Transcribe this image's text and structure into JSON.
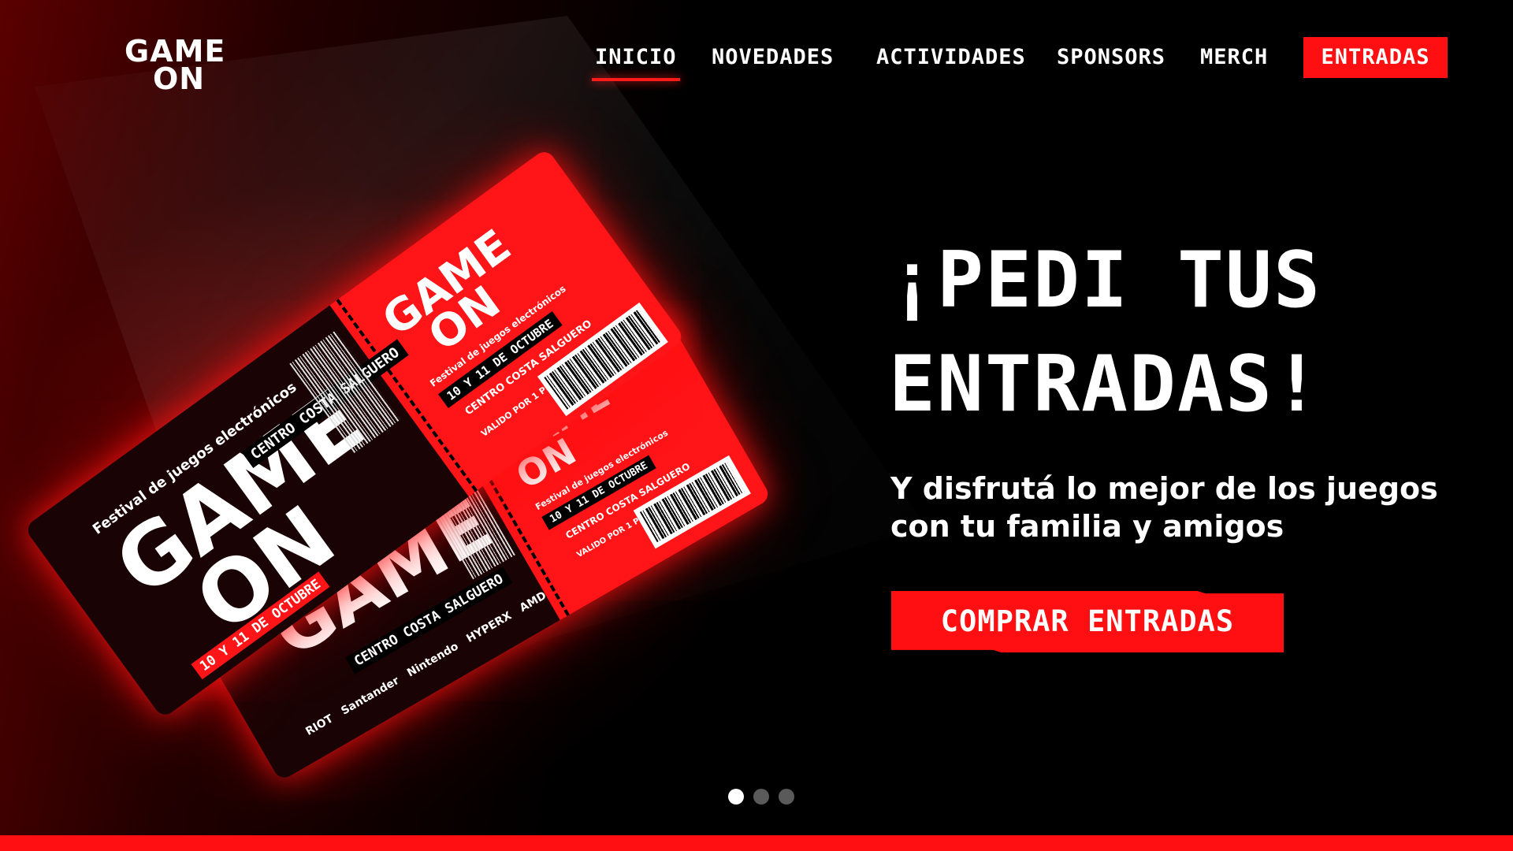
{
  "brand": {
    "line1": "GAME",
    "line2": "ON"
  },
  "nav": {
    "items": [
      {
        "label": "INICIO",
        "active": true
      },
      {
        "label": "NOVEDADES",
        "active": false
      },
      {
        "label": "ACTIVIDADES",
        "active": false
      },
      {
        "label": "SPONSORS",
        "active": false
      },
      {
        "label": "MERCH",
        "active": false
      }
    ],
    "cta_label": "ENTRADAS"
  },
  "hero": {
    "headline_line1": "¡PEDI TUS",
    "headline_line2": "ENTRADAS!",
    "subline_line1": "Y disfrutá lo mejor de los juegos",
    "subline_line2": "con tu familia y amigos",
    "cta_label": "COMPRAR ENTRADAS"
  },
  "ticket": {
    "logo_line1": "GAME",
    "logo_line2": "ON",
    "festival": "Festival de juegos electrónicos",
    "dates": "10 Y 11 DE OCTUBRE",
    "venue": "CENTRO COSTA SALGUERO",
    "valid": "VALIDO POR 1 PERSONA",
    "sponsors": [
      "RIOT",
      "Santander",
      "Nintendo",
      "HYPERX",
      "AMD"
    ]
  },
  "carousel": {
    "count": 3,
    "active_index": 0
  },
  "colors": {
    "accent": "#ff0f12",
    "background": "#000000",
    "text": "#ffffff"
  }
}
